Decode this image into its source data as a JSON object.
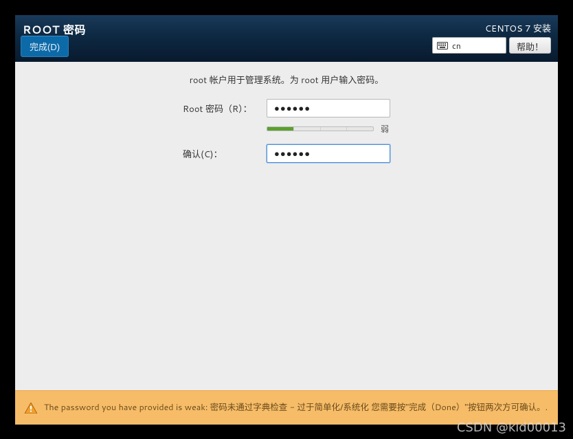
{
  "header": {
    "title": "ROOT 密码",
    "done_label": "完成(D)",
    "branding": "CENTOS 7 安装",
    "keyboard_layout": "cn",
    "help_label": "帮助！"
  },
  "form": {
    "intro": "root 帐户用于管理系统。为 root 用户输入密码。",
    "root_password_label": "Root 密码（R）：",
    "root_password_value": "●●●●●●",
    "confirm_label": "确认(C)：",
    "confirm_value": "●●●●●●",
    "strength_text": "弱",
    "strength_level": 1
  },
  "warning": {
    "message": "The password you have provided is weak: 密码未通过字典检查 - 过于简单化/系统化 您需要按\"完成（Done）\"按钮两次方可确认。."
  },
  "watermark": "CSDN @kid00013"
}
